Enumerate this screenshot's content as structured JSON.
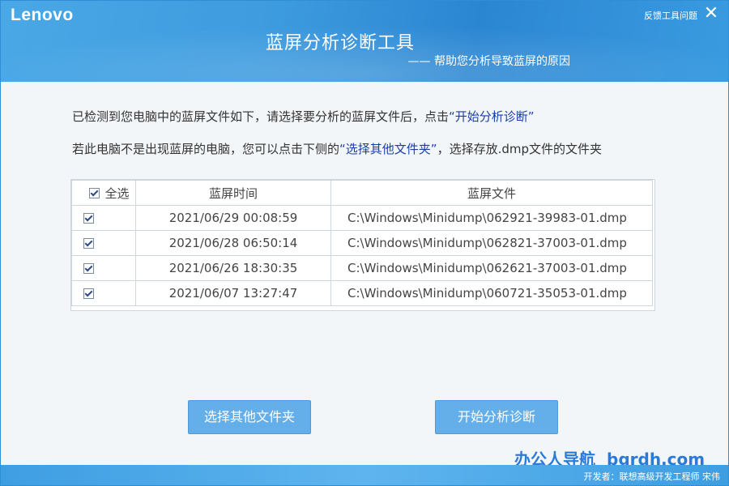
{
  "header": {
    "logo": "Lenovo",
    "feedback": "反馈工具问题",
    "close": "✕",
    "title": "蓝屏分析诊断工具",
    "subtitle": "—— 帮助您分析导致蓝屏的原因"
  },
  "instructions": {
    "line1_prefix": "已检测到您电脑中的蓝屏文件如下，请选择要分析的蓝屏文件后，点击",
    "line1_quote": "“开始分析诊断”",
    "line2_prefix": "若此电脑不是出现蓝屏的电脑，您可以点击下侧的",
    "line2_quote": "“选择其他文件夹”",
    "line2_suffix": "，选择存放.dmp文件的文件夹"
  },
  "table": {
    "select_all": "全选",
    "col_time": "蓝屏时间",
    "col_file": "蓝屏文件",
    "rows": [
      {
        "time": "2021/06/29 00:08:59",
        "file": "C:\\Windows\\Minidump\\062921-39983-01.dmp",
        "checked": true
      },
      {
        "time": "2021/06/28 06:50:14",
        "file": "C:\\Windows\\Minidump\\062821-37003-01.dmp",
        "checked": true
      },
      {
        "time": "2021/06/26 18:30:35",
        "file": "C:\\Windows\\Minidump\\062621-37003-01.dmp",
        "checked": true
      },
      {
        "time": "2021/06/07 13:27:47",
        "file": "C:\\Windows\\Minidump\\060721-35053-01.dmp",
        "checked": true
      }
    ]
  },
  "buttons": {
    "other_folder": "选择其他文件夹",
    "start": "开始分析诊断"
  },
  "watermark": {
    "cn": "办公人导航",
    "en": "bgrdh.com"
  },
  "footer": {
    "developer": "开发者：联想高级开发工程师 宋伟"
  },
  "colors": {
    "header": "#3e9cdf",
    "button": "#64aeea",
    "link_quote": "#1a3ea8",
    "watermark": "#2a7ad8"
  }
}
